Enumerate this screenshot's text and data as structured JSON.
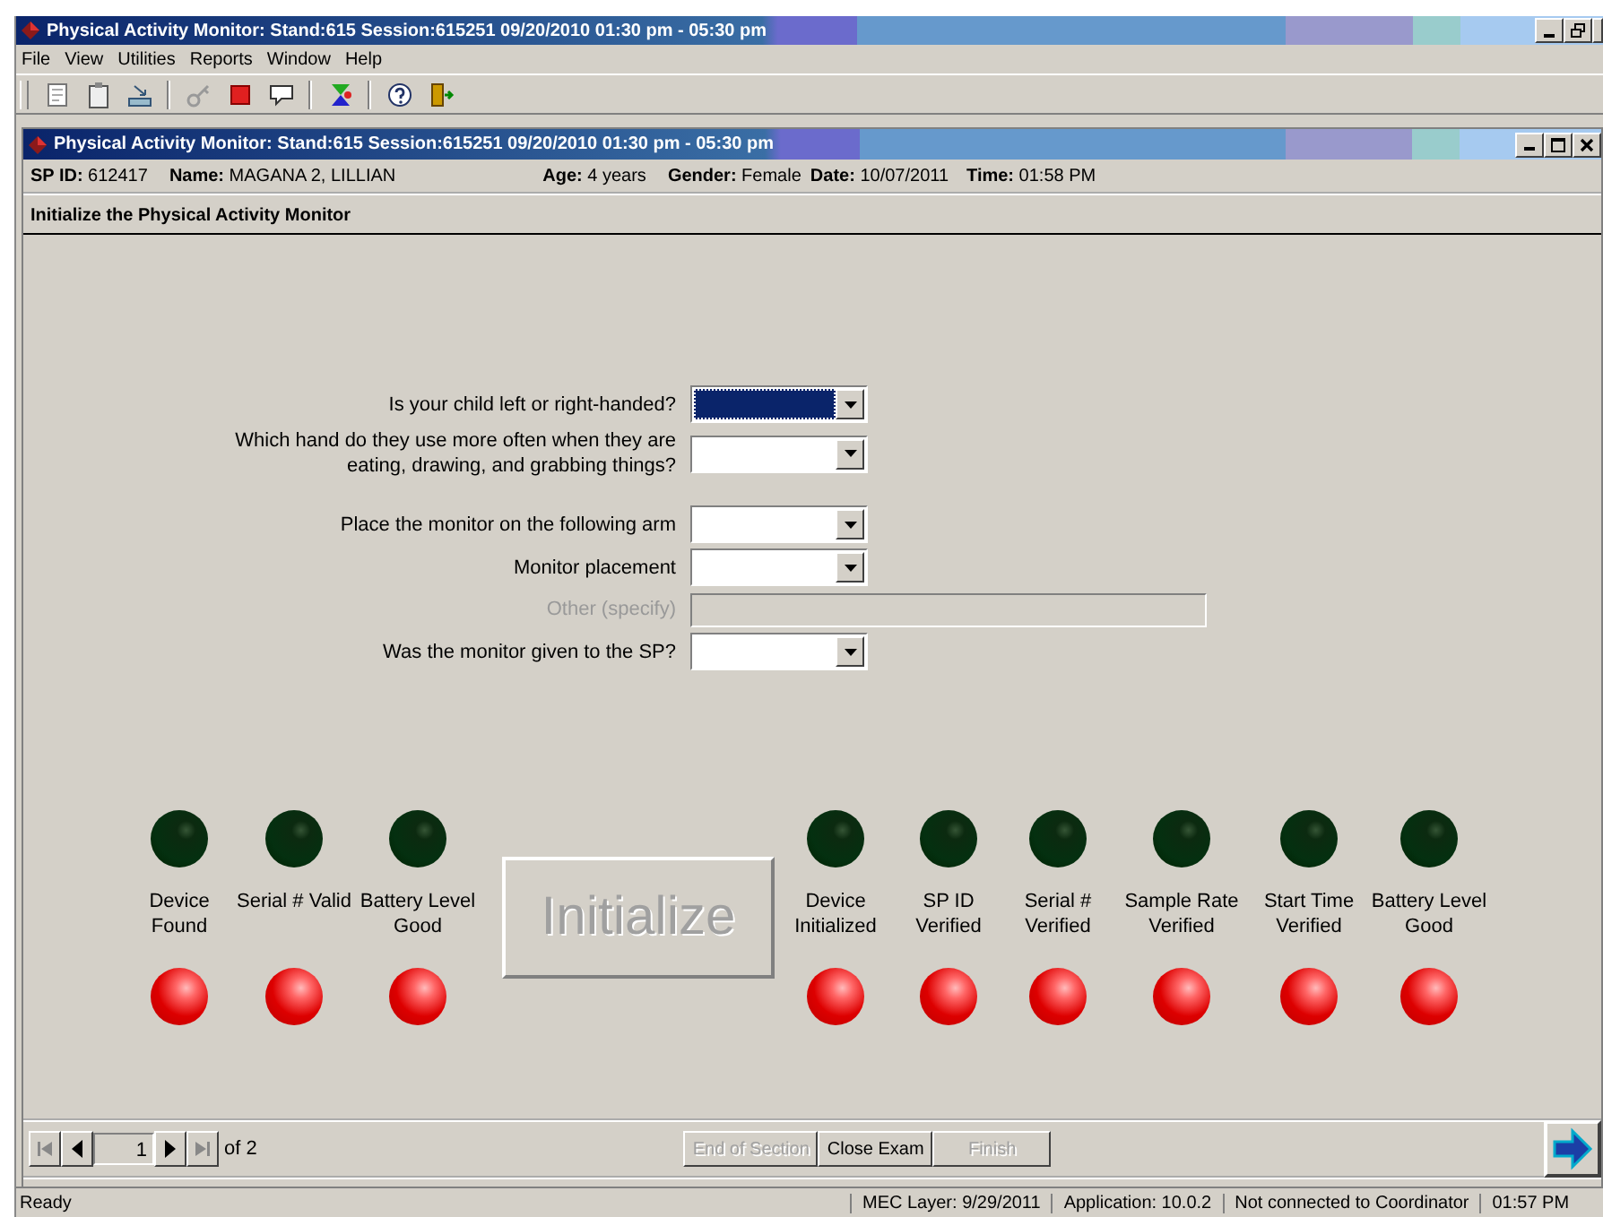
{
  "window": {
    "title": "Physical Activity Monitor: Stand:615 Session:615251 09/20/2010 01:30 pm - 05:30 pm"
  },
  "menu": [
    "File",
    "View",
    "Utilities",
    "Reports",
    "Window",
    "Help"
  ],
  "inner_window": {
    "title": "Physical Activity Monitor: Stand:615 Session:615251 09/20/2010 01:30 pm - 05:30 pm"
  },
  "info": [
    {
      "label": "SP ID:",
      "value": "612417"
    },
    {
      "label": "Name:",
      "value": "MAGANA 2, LILLIAN"
    },
    {
      "label": "Age:",
      "value": "4 years"
    },
    {
      "label": "Gender:",
      "value": "Female"
    },
    {
      "label": "Date:",
      "value": "10/07/2011"
    },
    {
      "label": "Time:",
      "value": "01:58 PM"
    }
  ],
  "section_title": "Initialize the Physical Activity Monitor",
  "questions": [
    {
      "kind": "dropdown",
      "label": "Is your child left or right-handed?",
      "disabled": false,
      "focused": true
    },
    {
      "kind": "dropdown",
      "label": "Which hand do they use more often when they are eating, drawing, and grabbing things?",
      "disabled": false,
      "focused": false
    },
    {
      "kind": "dropdown",
      "label": "Place the monitor on the following arm",
      "disabled": false,
      "focused": false
    },
    {
      "kind": "dropdown",
      "label": "Monitor placement",
      "disabled": false,
      "focused": false
    },
    {
      "kind": "text",
      "label": "Other (specify)",
      "disabled": true,
      "focused": false
    },
    {
      "kind": "dropdown",
      "label": "Was the monitor given to the SP?",
      "disabled": false,
      "focused": false
    }
  ],
  "indicators_left": [
    {
      "label": "Device Found",
      "passed": false
    },
    {
      "label": "Serial # Valid",
      "passed": false
    },
    {
      "label": "Battery Level Good",
      "passed": false
    }
  ],
  "initialize_button": {
    "label": "Initialize",
    "disabled": true
  },
  "indicators_right": [
    {
      "label": "Device Initialized",
      "passed": false
    },
    {
      "label": "SP ID Verified",
      "passed": false
    },
    {
      "label": "Serial # Verified",
      "passed": false
    },
    {
      "label": "Sample Rate Verified",
      "passed": false
    },
    {
      "label": "Start Time Verified",
      "passed": false
    },
    {
      "label": "Battery Level Good",
      "passed": false
    }
  ],
  "pager": {
    "page": "1",
    "total": "of 2"
  },
  "buttons": [
    {
      "label": "End of Section",
      "disabled": true
    },
    {
      "label": "Close Exam",
      "disabled": false
    },
    {
      "label": "Finish",
      "disabled": true
    }
  ],
  "status_bar": [
    "Ready",
    "MEC Layer: 9/29/2011",
    "Application: 10.0.2",
    "Not connected to Coordinator",
    "01:57 PM"
  ]
}
